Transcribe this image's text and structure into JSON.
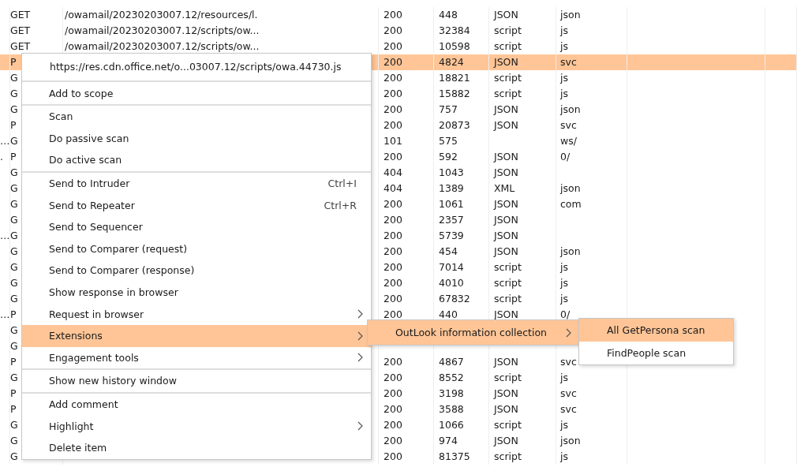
{
  "table": {
    "rows": [
      {
        "method": "GET",
        "url": "/owamail/20230203007.12/resources/l.",
        "status": "200",
        "length": "448",
        "mime": "JSON",
        "ext": "json",
        "selected": false
      },
      {
        "method": "GET",
        "url": "/owamail/20230203007.12/scripts/ow...",
        "status": "200",
        "length": "32384",
        "mime": "script",
        "ext": "js",
        "selected": false
      },
      {
        "method": "GET",
        "url": "/owamail/20230203007.12/scripts/ow...",
        "status": "200",
        "length": "10598",
        "mime": "script",
        "ext": "js",
        "selected": false
      },
      {
        "method": "P",
        "status": "200",
        "length": "4824",
        "mime": "JSON",
        "ext": "svc",
        "selected": true
      },
      {
        "method": "G",
        "status": "200",
        "length": "18821",
        "mime": "script",
        "ext": "js",
        "selected": false
      },
      {
        "method": "G",
        "status": "200",
        "length": "15882",
        "mime": "script",
        "ext": "js",
        "selected": false
      },
      {
        "method": "G",
        "status": "200",
        "length": "757",
        "mime": "JSON",
        "ext": "json",
        "selected": false
      },
      {
        "method": "P",
        "status": "200",
        "length": "20873",
        "mime": "JSON",
        "ext": "svc",
        "selected": false
      },
      {
        "lead": "…",
        "method": "G",
        "status": "101",
        "length": "575",
        "ext": "ws/",
        "selected": false
      },
      {
        "lead": ".",
        "method": "P",
        "status": "200",
        "length": "592",
        "mime": "JSON",
        "ext": "0/",
        "selected": false
      },
      {
        "method": "G",
        "status": "404",
        "length": "1043",
        "mime": "JSON",
        "selected": false
      },
      {
        "method": "G",
        "status": "404",
        "length": "1389",
        "mime": "XML",
        "ext": "json",
        "selected": false
      },
      {
        "method": "G",
        "status": "200",
        "length": "1061",
        "mime": "JSON",
        "ext": "com",
        "selected": false
      },
      {
        "method": "G",
        "status": "200",
        "length": "2357",
        "mime": "JSON",
        "selected": false
      },
      {
        "lead": "…",
        "method": "G",
        "status": "200",
        "length": "5739",
        "mime": "JSON",
        "selected": false
      },
      {
        "method": "G",
        "status": "200",
        "length": "454",
        "mime": "JSON",
        "ext": "json",
        "selected": false
      },
      {
        "method": "G",
        "status": "200",
        "length": "7014",
        "mime": "script",
        "ext": "js",
        "selected": false
      },
      {
        "method": "G",
        "status": "200",
        "length": "4010",
        "mime": "script",
        "ext": "js",
        "selected": false
      },
      {
        "method": "G",
        "status": "200",
        "length": "67832",
        "mime": "script",
        "ext": "js",
        "selected": false
      },
      {
        "lead": "…",
        "method": "P",
        "status": "200",
        "length": "440",
        "mime": "JSON",
        "ext": "0/",
        "selected": false
      },
      {
        "method": "G",
        "selected": false
      },
      {
        "method": "G",
        "selected": false
      },
      {
        "method": "P",
        "status": "200",
        "length": "4867",
        "mime": "JSON",
        "ext": "svc",
        "selected": false
      },
      {
        "method": "G",
        "status": "200",
        "length": "8552",
        "mime": "script",
        "ext": "js",
        "selected": false
      },
      {
        "method": "P",
        "status": "200",
        "length": "3198",
        "mime": "JSON",
        "ext": "svc",
        "selected": false
      },
      {
        "method": "P",
        "status": "200",
        "length": "3588",
        "mime": "JSON",
        "ext": "svc",
        "selected": false
      },
      {
        "method": "G",
        "status": "200",
        "length": "1066",
        "mime": "script",
        "ext": "js",
        "selected": false
      },
      {
        "method": "G",
        "status": "200",
        "length": "974",
        "mime": "JSON",
        "ext": "json",
        "selected": false
      },
      {
        "method": "G",
        "status": "200",
        "length": "81375",
        "mime": "script",
        "ext": "js",
        "selected": false
      }
    ]
  },
  "context_menu": {
    "header": "https://res.cdn.office.net/o...03007.12/scripts/owa.44730.js",
    "sections": [
      [
        {
          "label": "Add to scope",
          "submenu": false,
          "selected": false
        }
      ],
      [
        {
          "label": "Scan",
          "submenu": false,
          "selected": false
        },
        {
          "label": "Do passive scan",
          "submenu": false,
          "selected": false
        },
        {
          "label": "Do active scan",
          "submenu": false,
          "selected": false
        }
      ],
      [
        {
          "label": "Send to Intruder",
          "shortcut": "Ctrl+I",
          "submenu": false,
          "selected": false
        },
        {
          "label": "Send to Repeater",
          "shortcut": "Ctrl+R",
          "submenu": false,
          "selected": false
        },
        {
          "label": "Send to Sequencer",
          "submenu": false,
          "selected": false
        },
        {
          "label": "Send to Comparer (request)",
          "submenu": false,
          "selected": false
        },
        {
          "label": "Send to Comparer (response)",
          "submenu": false,
          "selected": false
        },
        {
          "label": "Show response in browser",
          "submenu": false,
          "selected": false
        },
        {
          "label": "Request in browser",
          "submenu": true,
          "selected": false
        },
        {
          "label": "Extensions",
          "submenu": true,
          "selected": true
        },
        {
          "label": "Engagement tools",
          "submenu": true,
          "selected": false
        }
      ],
      [
        {
          "label": "Show new history window",
          "submenu": false,
          "selected": false
        }
      ],
      [
        {
          "label": "Add comment",
          "submenu": false,
          "selected": false
        },
        {
          "label": "Highlight",
          "submenu": true,
          "selected": false
        },
        {
          "label": "Delete item",
          "submenu": false,
          "selected": false
        }
      ]
    ]
  },
  "extensions_submenu": {
    "items": [
      {
        "label": "OutLook information collection",
        "submenu": true,
        "selected": true
      }
    ]
  },
  "outlook_submenu": {
    "items": [
      {
        "label": "All GetPersona scan",
        "submenu": false,
        "selected": true
      },
      {
        "label": "FindPeople scan",
        "submenu": false,
        "selected": false
      }
    ]
  }
}
